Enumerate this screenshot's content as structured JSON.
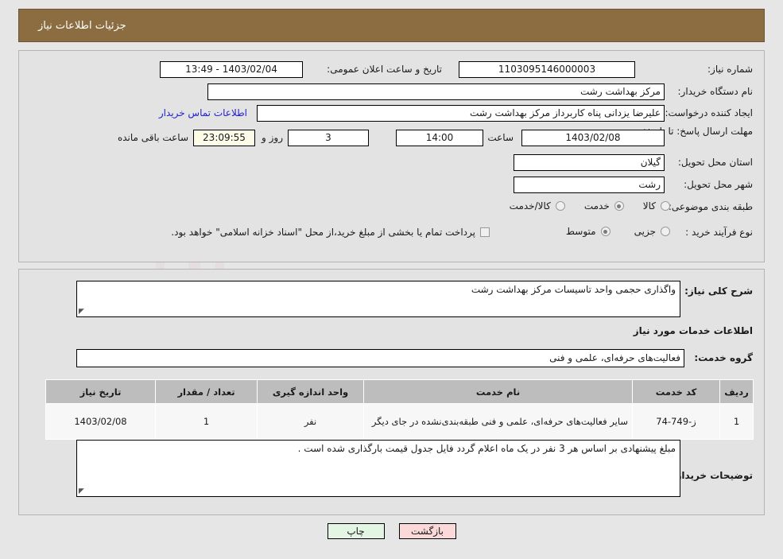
{
  "header": {
    "title": "جزئیات اطلاعات نیاز"
  },
  "fields": {
    "need_number_label": "شماره نیاز:",
    "need_number_value": "1103095146000003",
    "public_announce_label": "تاریخ و ساعت اعلان عمومی:",
    "public_announce_value": "1403/02/04 - 13:49",
    "buyer_org_label": "نام دستگاه خریدار:",
    "buyer_org_value": "مرکز بهداشت رشت",
    "creator_label": "ایجاد کننده درخواست:",
    "creator_value": "علیرضا یزدانی پناه کاربرداز مرکز بهداشت رشت",
    "contact_link": "اطلاعات تماس خریدار",
    "deadline_label": "مهلت ارسال پاسخ: تا تاریخ:",
    "deadline_date": "1403/02/08",
    "hour_label": "ساعت",
    "deadline_time": "14:00",
    "days_value": "3",
    "days_label": "روز و",
    "countdown_value": "23:09:55",
    "remaining_label": "ساعت باقی مانده",
    "province_label": "استان محل تحویل:",
    "province_value": "گیلان",
    "city_label": "شهر محل تحویل:",
    "city_value": "رشت",
    "category_label": "طبقه بندی موضوعی:",
    "process_label": "نوع فرآیند خرید :",
    "treasury_note": "پرداخت تمام یا بخشی از مبلغ خرید،از محل \"اسناد خزانه اسلامی\" خواهد بود."
  },
  "category_options": [
    {
      "label": "کالا",
      "selected": false
    },
    {
      "label": "خدمت",
      "selected": true
    },
    {
      "label": "کالا/خدمت",
      "selected": false
    }
  ],
  "process_options": [
    {
      "label": "جزیی",
      "selected": false
    },
    {
      "label": "متوسط",
      "selected": true
    }
  ],
  "treasury_checkbox_checked": false,
  "description": {
    "label": "شرح کلی نیاز:",
    "value": "واگذاری حجمی واحد تاسیسات مرکز بهداشت رشت"
  },
  "services_section": {
    "title": "اطلاعات خدمات مورد نیاز",
    "group_label": "گروه خدمت:",
    "group_value": "فعالیت‌های حرفه‌ای، علمی و فنی"
  },
  "table": {
    "columns": [
      "ردیف",
      "کد خدمت",
      "نام خدمت",
      "واحد اندازه گیری",
      "تعداد / مقدار",
      "تاریخ نیاز"
    ],
    "rows": [
      {
        "row_no": "1",
        "service_code": "ز-749-74",
        "service_name": "سایر فعالیت‌های حرفه‌ای، علمی و فنی طبقه‌بندی‌نشده در جای دیگر",
        "unit": "نفر",
        "quantity": "1",
        "need_date": "1403/02/08"
      }
    ]
  },
  "buyer_notes": {
    "label": "توضیحات خریدار:",
    "value": "مبلغ پیشنهادی بر اساس هر 3 نفر در یک ماه اعلام گردد فایل جدول قیمت بارگذاری شده است ."
  },
  "buttons": {
    "print": "چاپ",
    "back": "بازگشت"
  },
  "watermark": {
    "text": "AriaTender.net"
  },
  "colors": {
    "header_bg": "#8c6d41",
    "panel_bg": "#e3e3e3",
    "page_bg": "#e6e6e6",
    "link": "#2222cc",
    "timer_bg": "#fbfbe8",
    "print_btn": "#e3f5e3",
    "back_btn": "#fbd9d9",
    "table_header": "#bdbdbd"
  }
}
